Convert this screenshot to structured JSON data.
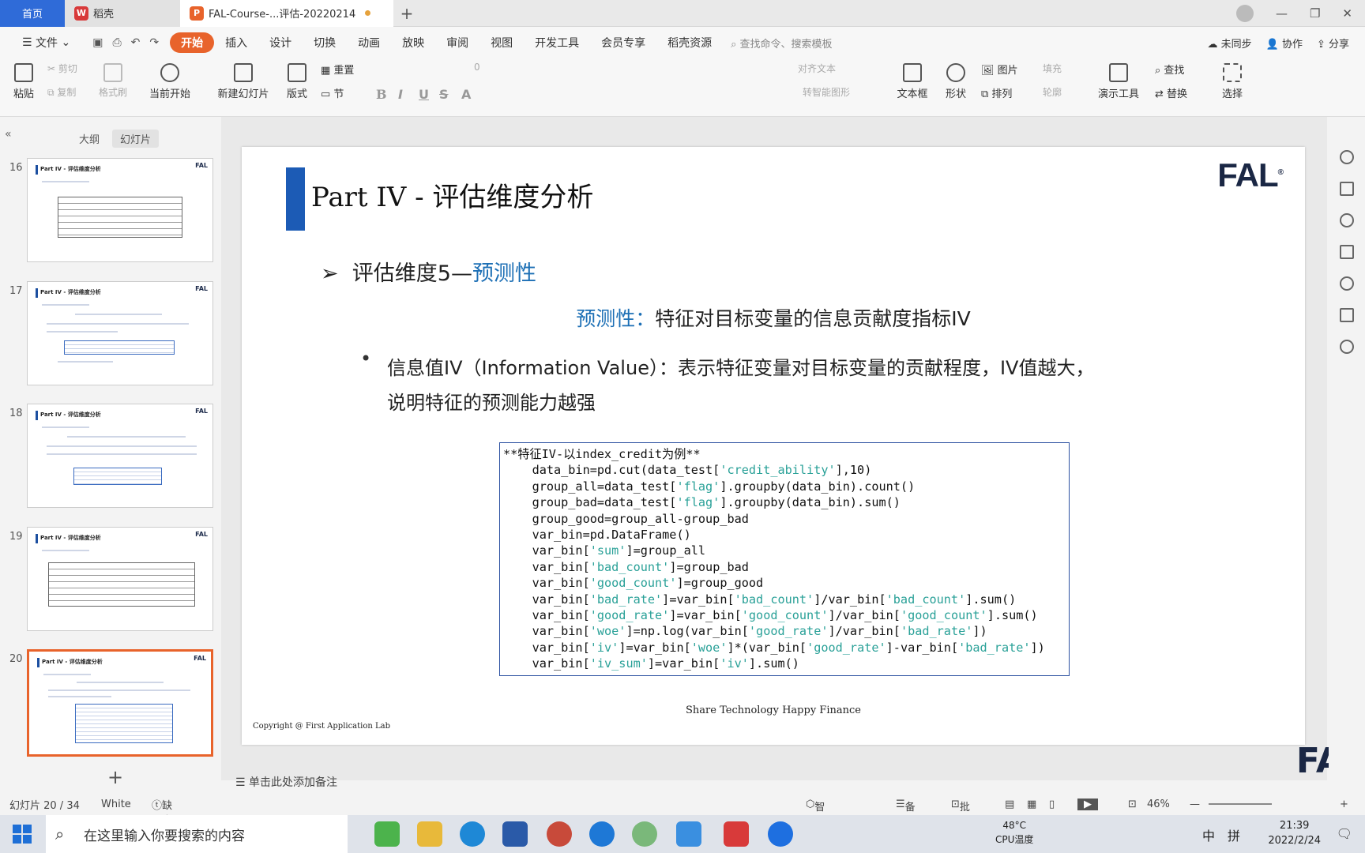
{
  "tabs": {
    "home": "首页",
    "daoke": "稻壳",
    "document": "FAL-Course-...评估-20220214"
  },
  "menu": {
    "file": "文件",
    "items": [
      "开始",
      "插入",
      "设计",
      "切换",
      "动画",
      "放映",
      "审阅",
      "视图",
      "开发工具",
      "会员专享",
      "稻壳资源"
    ],
    "search": "查找命令、搜索模板",
    "sync": "未同步",
    "collab": "协作",
    "share": "分享"
  },
  "ribbon": {
    "paste": "粘贴",
    "cut": "剪切",
    "copy": "复制",
    "format_painter": "格式刷",
    "from_current": "当前开始",
    "new_slide": "新建幻灯片",
    "layout": "版式",
    "reset": "重置",
    "section": "节",
    "align_text": "对齐文本",
    "smart_shape": "转智能图形",
    "textbox": "文本框",
    "shape": "形状",
    "picture": "图片",
    "fill": "填充",
    "arrange": "排列",
    "outline": "轮廓",
    "present_tools": "演示工具",
    "find": "查找",
    "replace": "替换",
    "select": "选择",
    "font_size": "0"
  },
  "left_panel": {
    "outline_tab": "大纲",
    "slides_tab": "幻灯片",
    "thumbs": [
      {
        "num": "16",
        "title": "Part IV - 评估维度分析",
        "logo": "FAL"
      },
      {
        "num": "17",
        "title": "Part IV - 评估维度分析",
        "logo": "FAL"
      },
      {
        "num": "18",
        "title": "Part IV - 评估维度分析",
        "logo": "FAL"
      },
      {
        "num": "19",
        "title": "Part IV - 评估维度分析",
        "logo": "FAL"
      },
      {
        "num": "20",
        "title": "Part IV - 评估维度分析",
        "logo": "FAL"
      }
    ],
    "add": "+"
  },
  "slide": {
    "title": "Part IV - 评估维度分析",
    "logo": "FAL",
    "bullet_prefix": "评估维度5—",
    "bullet_highlight": "预测性",
    "sub_highlight": "预测性：",
    "sub_text": "特征对目标变量的信息贡献度指标IV",
    "para_line1": "信息值IV（Information Value）：表示特征变量对目标变量的贡献程度，IV值越大，",
    "para_line2": "说明特征的预测能力越强",
    "code_lines": [
      "**特征IV-以index_credit为例**",
      "    data_bin=pd.cut(data_test['credit_ability'],10)",
      "    group_all=data_test['flag'].groupby(data_bin).count()",
      "    group_bad=data_test['flag'].groupby(data_bin).sum()",
      "    group_good=group_all-group_bad",
      "    var_bin=pd.DataFrame()",
      "    var_bin['sum']=group_all",
      "    var_bin['bad_count']=group_bad",
      "    var_bin['good_count']=group_good",
      "    var_bin['bad_rate']=var_bin['bad_count']/var_bin['bad_count'].sum()",
      "    var_bin['good_rate']=var_bin['good_count']/var_bin['good_count'].sum()",
      "    var_bin['woe']=np.log(var_bin['good_rate']/var_bin['bad_rate'])",
      "    var_bin['iv']=var_bin['woe']*(var_bin['good_rate']-var_bin['bad_rate'])",
      "    var_bin['iv_sum']=var_bin['iv'].sum()"
    ],
    "footer": "Share Technology Happy Finance",
    "copyright": "Copyright @ First Application Lab"
  },
  "notes_placeholder": "单击此处添加备注",
  "status": {
    "slide_count": "幻灯片 20 / 34",
    "theme": "White",
    "missing_font": "缺失字体",
    "beautify": "智能美化",
    "notes": "备注",
    "comments": "批注",
    "zoom": "46%"
  },
  "taskbar": {
    "search": "在这里输入你要搜索的内容",
    "temp": "48°C",
    "temp_label": "CPU温度",
    "ime1": "中",
    "ime2": "拼",
    "time": "21:39",
    "date": "2022/2/24"
  },
  "colors": {
    "accent": "#e8632b",
    "slide_blue": "#1c5bb5",
    "highlight": "#1c6fb5"
  }
}
